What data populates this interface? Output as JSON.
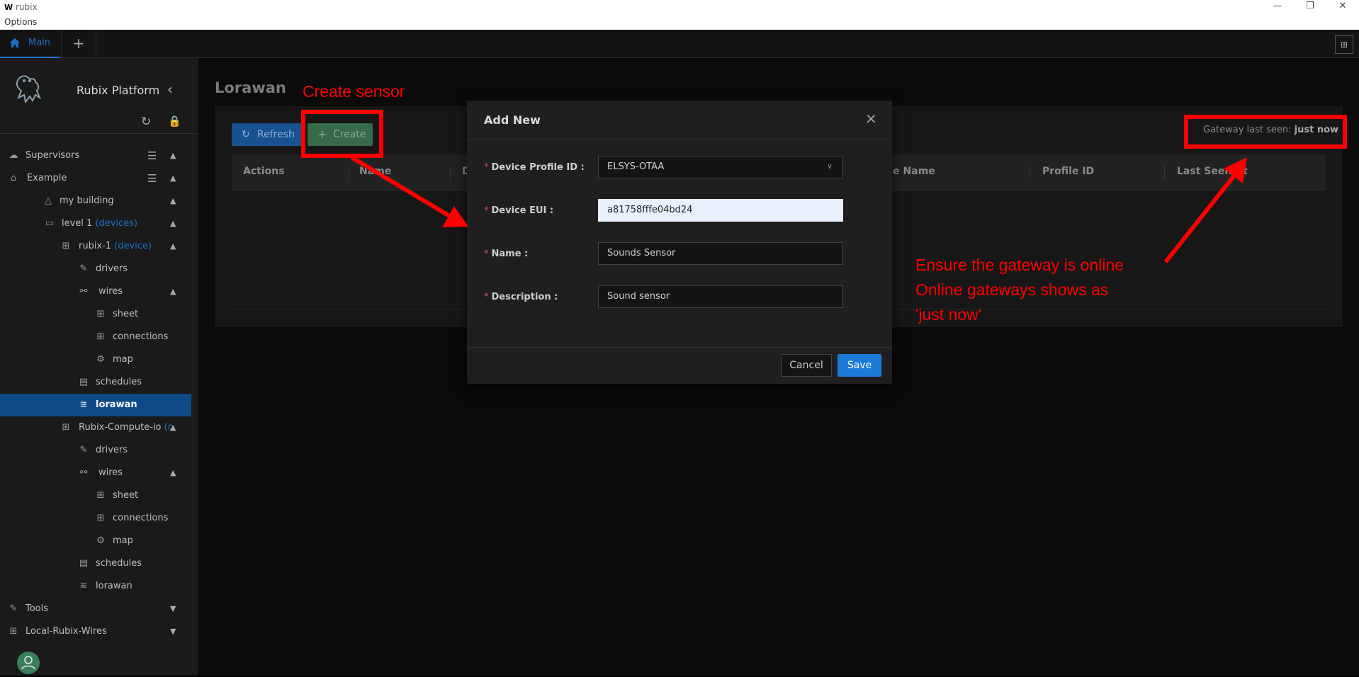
{
  "window": {
    "logo": "W",
    "title": "rubix",
    "menu": "Options",
    "minimize": "—",
    "restore": "❐",
    "close": "✕"
  },
  "tabs": {
    "main_label": "Main",
    "add": "+",
    "layout_icon": "⊞"
  },
  "sidebar": {
    "brand": "Rubix Platform",
    "items": [
      {
        "label": "Supervisors",
        "tag": ""
      },
      {
        "label": "Example",
        "tag": ""
      },
      {
        "label": "my building",
        "tag": ""
      },
      {
        "label": "level 1",
        "tag": "(devices)"
      },
      {
        "label": "rubix-1",
        "tag": "(device)"
      },
      {
        "label": "drivers",
        "tag": ""
      },
      {
        "label": "wires",
        "tag": ""
      },
      {
        "label": "sheet",
        "tag": ""
      },
      {
        "label": "connections",
        "tag": ""
      },
      {
        "label": "map",
        "tag": ""
      },
      {
        "label": "schedules",
        "tag": ""
      },
      {
        "label": "lorawan",
        "tag": ""
      },
      {
        "label": "Rubix-Compute-io",
        "tag": "(c"
      },
      {
        "label": "drivers",
        "tag": ""
      },
      {
        "label": "wires",
        "tag": ""
      },
      {
        "label": "sheet",
        "tag": ""
      },
      {
        "label": "connections",
        "tag": ""
      },
      {
        "label": "map",
        "tag": ""
      },
      {
        "label": "schedules",
        "tag": ""
      },
      {
        "label": "lorawan",
        "tag": ""
      },
      {
        "label": "Tools",
        "tag": ""
      },
      {
        "label": "Local-Rubix-Wires",
        "tag": ""
      }
    ]
  },
  "page": {
    "title": "Lorawan",
    "refresh_label": "Refresh",
    "create_label": "Create",
    "gateway_label": "Gateway last seen:",
    "gateway_value": "just now",
    "columns": [
      "Actions",
      "Name",
      "D",
      "file Name",
      "Profile ID",
      "Last Seen At"
    ]
  },
  "modal": {
    "title": "Add New",
    "close": "✕",
    "fields": {
      "profile": {
        "label": "Device Profile ID",
        "value": "ELSYS-OTAA"
      },
      "eui": {
        "label": "Device EUI",
        "value": "a81758fffe04bd24"
      },
      "name": {
        "label": "Name",
        "value": "Sounds Sensor"
      },
      "description": {
        "label": "Description",
        "value": "Sound sensor"
      }
    },
    "cancel_label": "Cancel",
    "save_label": "Save"
  },
  "annotations": {
    "create_sensor": "Create sensor",
    "gateway_note_1": "Ensure the gateway is online",
    "gateway_note_2": "Online gateways shows as",
    "gateway_note_3": "'just now'"
  }
}
